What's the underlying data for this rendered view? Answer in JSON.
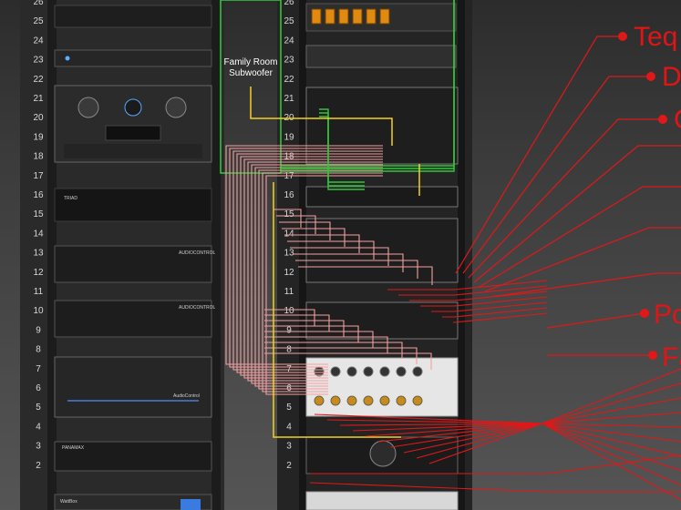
{
  "diagram": {
    "left_rack_units": [
      "26",
      "25",
      "24",
      "23",
      "22",
      "21",
      "20",
      "19",
      "18",
      "17",
      "16",
      "15",
      "14",
      "13",
      "12",
      "11",
      "10",
      "9",
      "8",
      "7",
      "6",
      "5",
      "4",
      "3",
      "2"
    ],
    "right_rack_units": [
      "26",
      "25",
      "24",
      "23",
      "22",
      "21",
      "20",
      "19",
      "18",
      "17",
      "16",
      "15",
      "14",
      "13",
      "12",
      "11",
      "10",
      "9",
      "8",
      "7",
      "6",
      "5",
      "4",
      "3",
      "2"
    ],
    "subwoofer_label_line1": "Family Room",
    "subwoofer_label_line2": "Subwoofer",
    "device_labels": {
      "triad_logo": "TRIAD",
      "amp_brand_1": "AUDIOCONTROL",
      "amp_brand_2": "AUDIOCONTROL",
      "amp_brand_3": "AudioControl",
      "panamax": "PANAMAX",
      "ups": "WattBox"
    },
    "callouts": [
      {
        "text": "Teq"
      },
      {
        "text": "D"
      },
      {
        "text": "G"
      },
      {
        "text": "Po"
      },
      {
        "text": "Fa"
      }
    ],
    "colors": {
      "red_wire": "#e01818",
      "pink_wire": "#f4a0a0",
      "green_wire": "#35c43a",
      "yellow_wire": "#f2d21e",
      "rack_rail": "#202020"
    }
  }
}
